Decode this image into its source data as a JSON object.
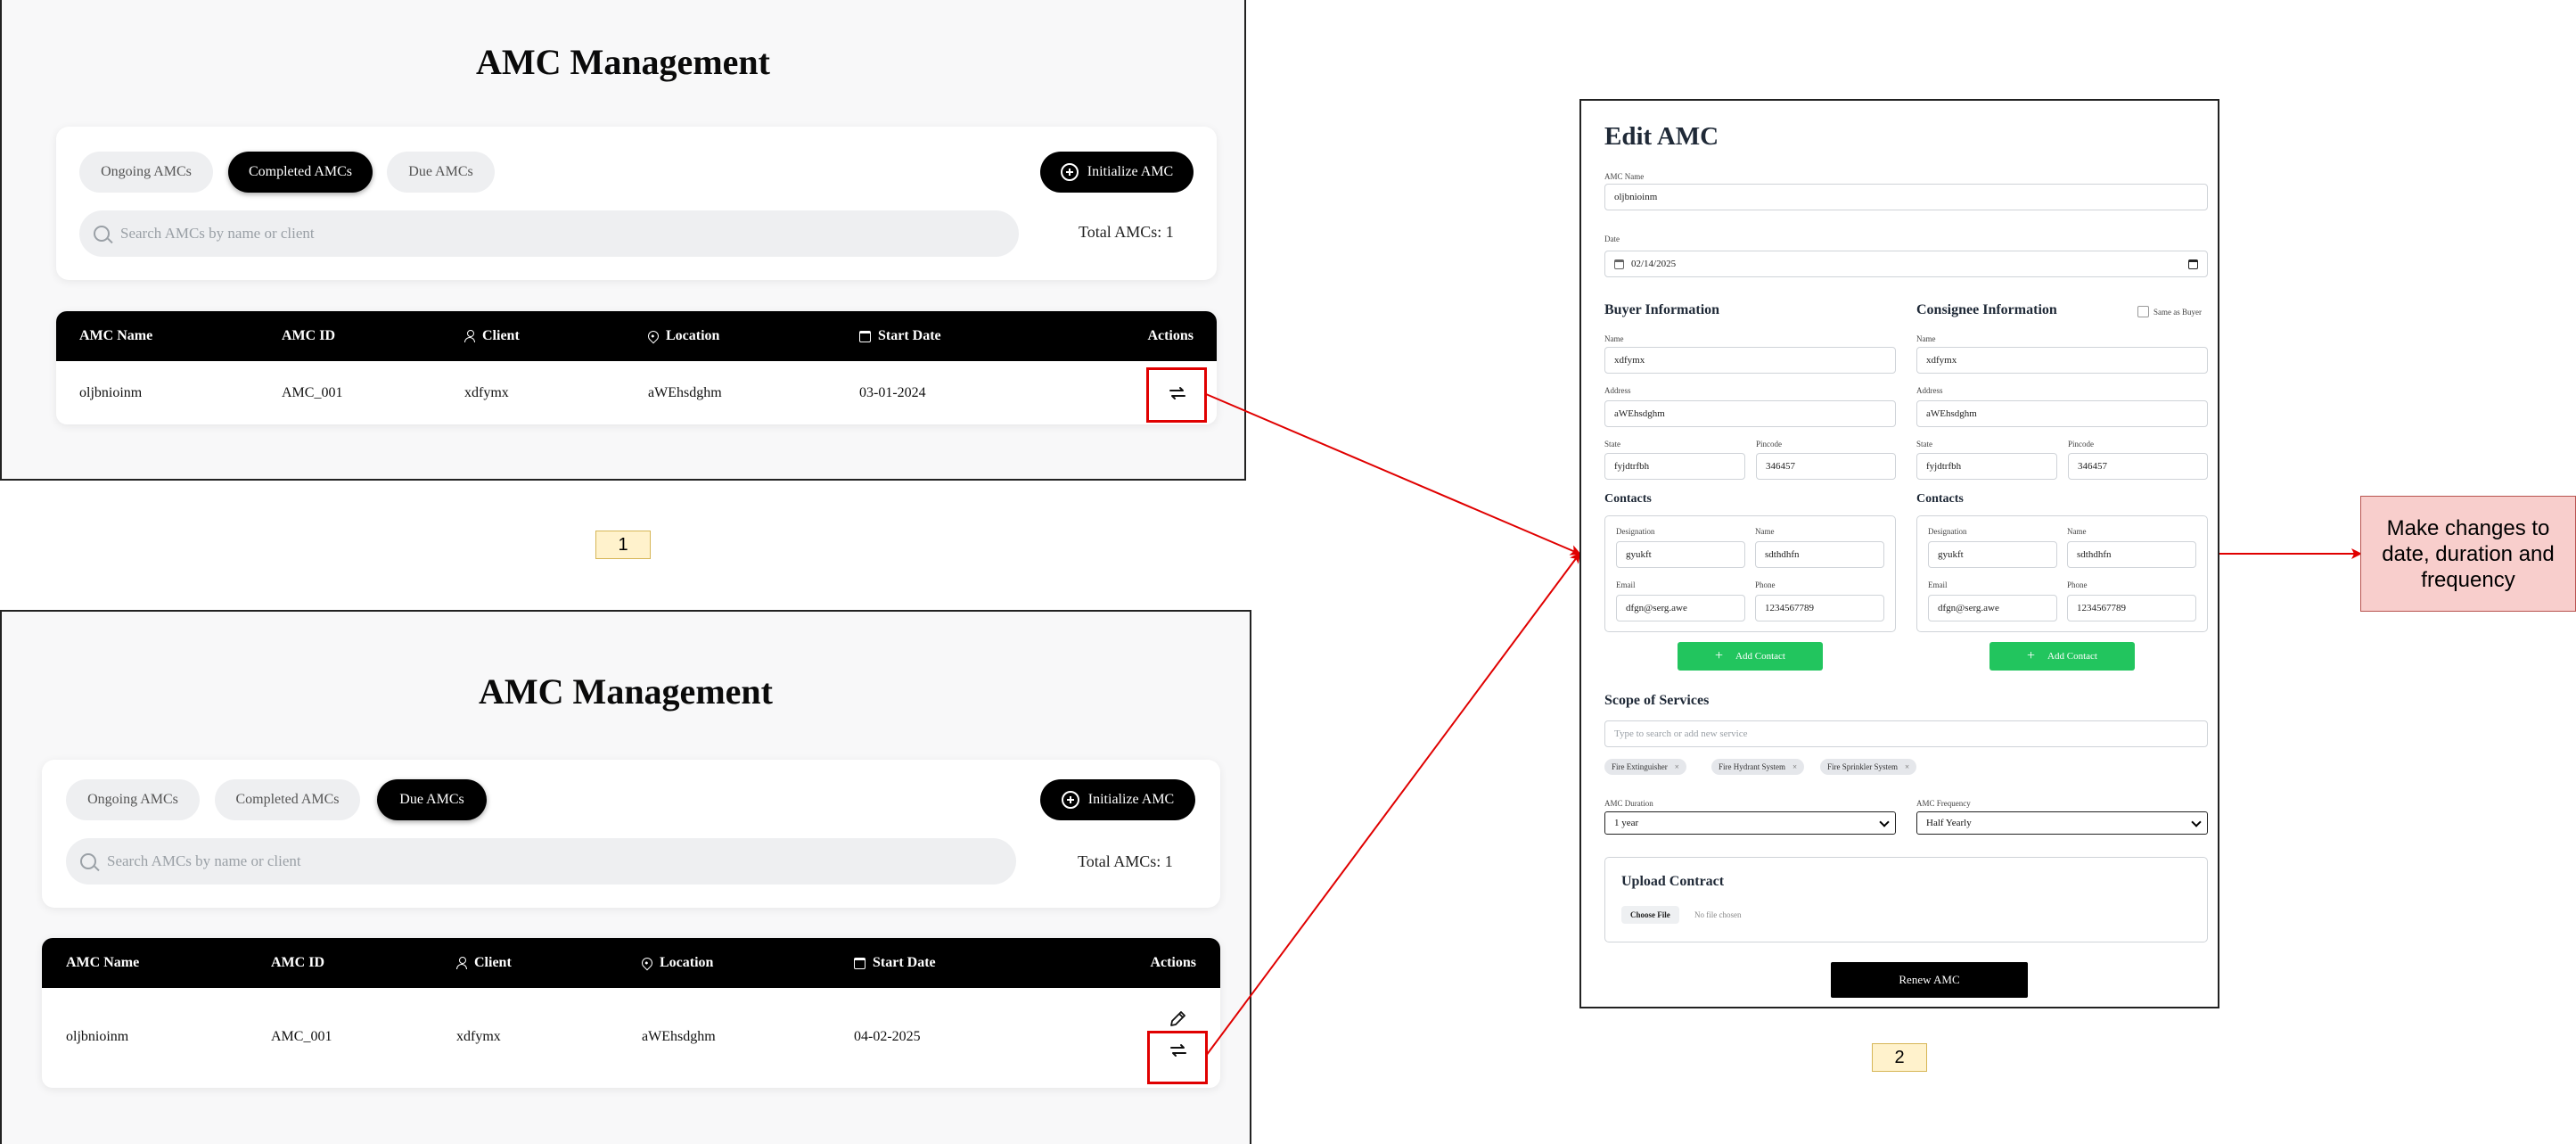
{
  "screen1": {
    "title": "AMC Management",
    "tabs": [
      "Ongoing AMCs",
      "Completed AMCs",
      "Due AMCs"
    ],
    "active_tab": "Completed AMCs",
    "init_button": "Initialize AMC",
    "search_placeholder": "Search AMCs by name or client",
    "total": "Total AMCs: 1",
    "columns": [
      "AMC Name",
      "AMC ID",
      "Client",
      "Location",
      "Start Date",
      "Actions"
    ],
    "row": {
      "name": "oljbnioinm",
      "id": "AMC_001",
      "client": "xdfymx",
      "location": "aWEhsdghm",
      "start_date": "03-01-2024"
    },
    "actions": [
      "renew-icon"
    ]
  },
  "screen3": {
    "title": "AMC Management",
    "tabs": [
      "Ongoing AMCs",
      "Completed AMCs",
      "Due AMCs"
    ],
    "active_tab": "Due AMCs",
    "init_button": "Initialize AMC",
    "search_placeholder": "Search AMCs by name or client",
    "total": "Total AMCs: 1",
    "columns": [
      "AMC Name",
      "AMC ID",
      "Client",
      "Location",
      "Start Date",
      "Actions"
    ],
    "row": {
      "name": "oljbnioinm",
      "id": "AMC_001",
      "client": "xdfymx",
      "location": "aWEhsdghm",
      "start_date": "04-02-2025"
    },
    "actions": [
      "edit-icon",
      "renew-icon"
    ]
  },
  "labels": {
    "one": "1",
    "two": "2"
  },
  "note": "Make changes to date, duration and frequency",
  "edit_form": {
    "title": "Edit AMC",
    "amc_name_label": "AMC Name",
    "amc_name": "oljbnioinm",
    "date_label": "Date",
    "date": "02/14/2025",
    "buyer": {
      "heading": "Buyer Information",
      "name_label": "Name",
      "name": "xdfymx",
      "address_label": "Address",
      "address": "aWEhsdghm",
      "state_label": "State",
      "state": "fyjdtrfbh",
      "pincode_label": "Pincode",
      "pincode": "346457",
      "contacts_heading": "Contacts",
      "designation_label": "Designation",
      "designation": "gyukft",
      "cname_label": "Name",
      "cname": "sdthdhfn",
      "email_label": "Email",
      "email": "dfgn@serg.awe",
      "phone_label": "Phone",
      "phone": "1234567789",
      "add_contact": "Add Contact"
    },
    "consignee": {
      "heading": "Consignee Information",
      "same_as_buyer": "Same as Buyer",
      "name_label": "Name",
      "name": "xdfymx",
      "address_label": "Address",
      "address": "aWEhsdghm",
      "state_label": "State",
      "state": "fyjdtrfbh",
      "pincode_label": "Pincode",
      "pincode": "346457",
      "contacts_heading": "Contacts",
      "designation_label": "Designation",
      "designation": "gyukft",
      "cname_label": "Name",
      "cname": "sdthdhfn",
      "email_label": "Email",
      "email": "dfgn@serg.awe",
      "phone_label": "Phone",
      "phone": "1234567789",
      "add_contact": "Add Contact"
    },
    "scope_heading": "Scope of Services",
    "scope_placeholder": "Type to search or add new service",
    "services": [
      "Fire Extinguisher",
      "Fire Hydrant System",
      "Fire Sprinkler System"
    ],
    "duration_label": "AMC Duration",
    "duration": "1 year",
    "frequency_label": "AMC Frequency",
    "frequency": "Half Yearly",
    "upload_heading": "Upload Contract",
    "choose_file": "Choose File",
    "no_file": "No file chosen",
    "renew_button": "Renew AMC"
  },
  "colors": {
    "arrow": "#e00000",
    "accent_black": "#000000",
    "green": "#22c55e",
    "note_fill": "#f8cecc",
    "label_fill": "#fff2cc"
  }
}
